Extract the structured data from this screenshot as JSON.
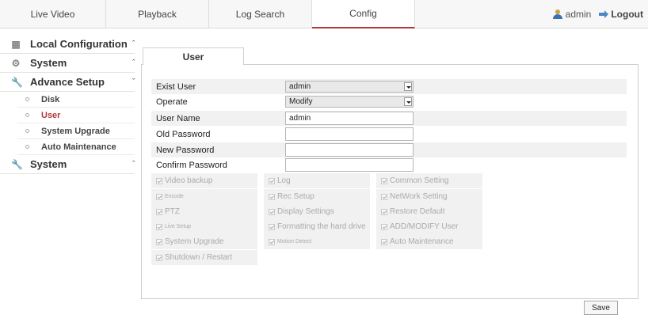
{
  "nav": {
    "tabs": [
      {
        "label": "Live Video"
      },
      {
        "label": "Playback"
      },
      {
        "label": "Log Search"
      },
      {
        "label": "Config"
      }
    ],
    "user": "admin",
    "logout": "Logout"
  },
  "sidebar": {
    "local_configuration": "Local Configuration",
    "system": "System",
    "advance_setup": "Advance Setup",
    "sub": [
      "Disk",
      "User",
      "System Upgrade",
      "Auto Maintenance"
    ],
    "system2": "System"
  },
  "tab": "User",
  "form": {
    "exist_user_label": "Exist User",
    "exist_user_value": "admin",
    "operate_label": "Operate",
    "operate_value": "Modify",
    "user_name_label": "User Name",
    "user_name_value": "admin",
    "old_password_label": "Old Password",
    "new_password_label": "New Password",
    "confirm_password_label": "Confirm Password"
  },
  "permissions": {
    "col1": [
      "Video backup",
      "Encode",
      "PTZ",
      "Live Setup",
      "System Upgrade",
      "Shutdown / Restart"
    ],
    "col2": [
      "Log",
      "Rec Setup",
      "Display Settings",
      "Formatting the hard drive",
      "Motion Detect"
    ],
    "col3": [
      "Common Setting",
      "NetWork Setting",
      "Restore Default",
      "ADD/MODIFY User",
      "Auto Maintenance"
    ]
  },
  "save": "Save"
}
